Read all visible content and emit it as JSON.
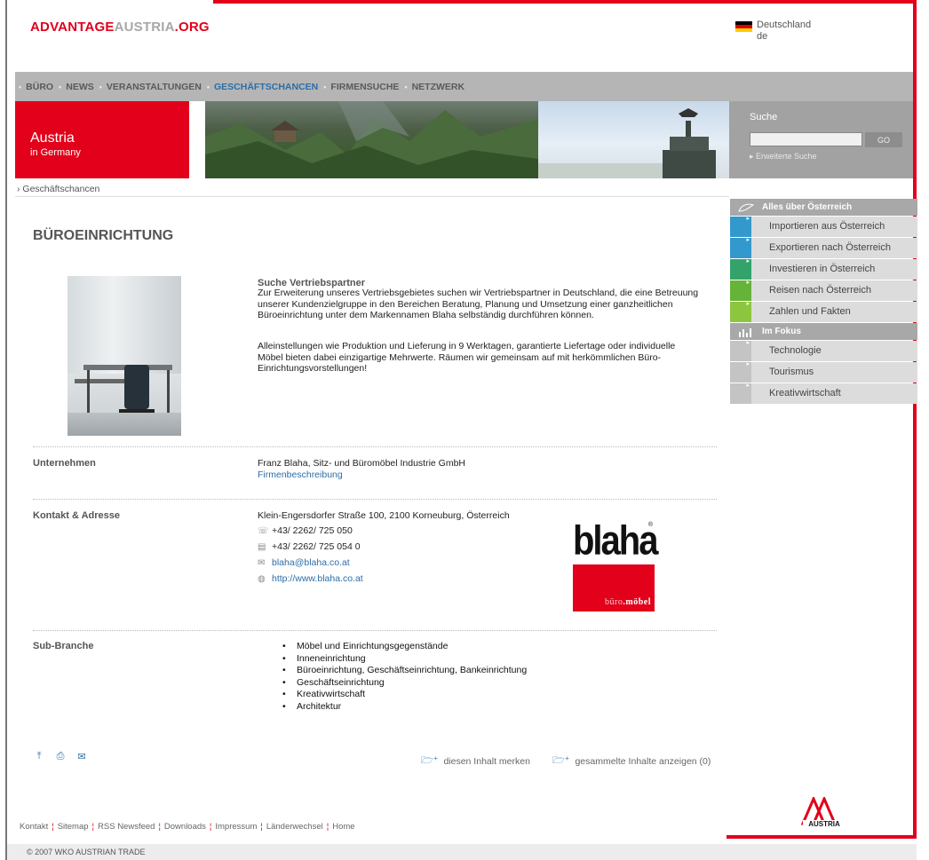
{
  "header": {
    "logo_part1": "ADVANTAGE",
    "logo_part2": "AUSTRIA",
    "logo_part3": ".ORG",
    "country": "Deutschland",
    "lang_code": "de"
  },
  "nav": {
    "items": [
      "BÜRO",
      "NEWS",
      "VERANSTALTUNGEN",
      "GESCHÄFTSCHANCEN",
      "FIRMENSUCHE",
      "NETZWERK"
    ],
    "active_index": 3
  },
  "banner": {
    "title": "Austria",
    "subtitle": "in Germany"
  },
  "search": {
    "label": "Suche",
    "placeholder": "",
    "go_label": "GO",
    "advanced": "Erweiterte Suche"
  },
  "breadcrumb": "Geschäftschancen",
  "sidebar": {
    "section1_title": "Alles über Österreich",
    "section1_items": [
      {
        "label": "Importieren aus Österreich",
        "color": "#3399cc"
      },
      {
        "label": "Exportieren nach Österreich",
        "color": "#3399cc"
      },
      {
        "label": "Investieren in Österreich",
        "color": "#33a36b"
      },
      {
        "label": "Reisen nach Österreich",
        "color": "#66b33a"
      },
      {
        "label": "Zahlen und Fakten",
        "color": "#8cc63f"
      }
    ],
    "section2_title": "Im Fokus",
    "section2_items": [
      {
        "label": "Technologie",
        "color": "#c4c4c4"
      },
      {
        "label": "Tourismus",
        "color": "#c4c4c4"
      },
      {
        "label": "Kreativwirtschaft",
        "color": "#c4c4c4"
      }
    ]
  },
  "main": {
    "title": "BÜROEINRICHTUNG",
    "offer_title": "Suche Vertriebspartner",
    "offer_p1": "Zur Erweiterung unseres Vertriebsgebietes suchen wir Vertriebspartner in Deutschland, die eine Betreuung unserer Kundenzielgruppe in den Bereichen Beratung, Planung und Umsetzung einer ganzheitlichen Büroeinrichtung unter dem Markennamen Blaha selbständig durchführen können.",
    "offer_p2": "Alleinstellungen wie Produktion und Lieferung in 9 Werktagen, garantierte Liefertage oder individuelle Möbel bieten dabei einzigartige Mehrwerte. Räumen wir gemeinsam auf mit herkömmlichen Büro-Einrichtungsvorstellungen!",
    "company_label": "Unternehmen",
    "company_name": "Franz Blaha, Sitz- und Büromöbel Industrie GmbH",
    "company_link": "Firmenbeschreibung",
    "contact_label": "Kontakt & Adresse",
    "address": "Klein-Engersdorfer Straße 100, 2100 Korneuburg, Österreich",
    "phone": "+43/ 2262/ 725 050",
    "fax": "+43/ 2262/ 725 054 0",
    "email": "blaha@blaha.co.at",
    "web": "http://www.blaha.co.at",
    "brand_word": "blaha",
    "brand_reg": "®",
    "brand_sub_1": "büro",
    "brand_sub_2": ".möbel",
    "subbranch_label": "Sub-Branche",
    "subbranches": [
      "Möbel und Einrichtungsgegenstände",
      "Inneneinrichtung",
      "Büroeinrichtung, Geschäftseinrichtung, Bankeinrichtung",
      "Geschäftseinrichtung",
      "Kreativwirtschaft",
      "Architektur"
    ],
    "memo": "diesen Inhalt merken",
    "show_collected": "gesammelte Inhalte anzeigen (0)"
  },
  "footer": {
    "links": [
      "Kontakt",
      "Sitemap",
      "RSS Newsfeed",
      "Downloads",
      "Impressum",
      "Länderwechsel",
      "Home"
    ],
    "logo_text": "AUSTRIA",
    "copyright": "© 2007 WKO AUSTRIAN TRADE"
  }
}
